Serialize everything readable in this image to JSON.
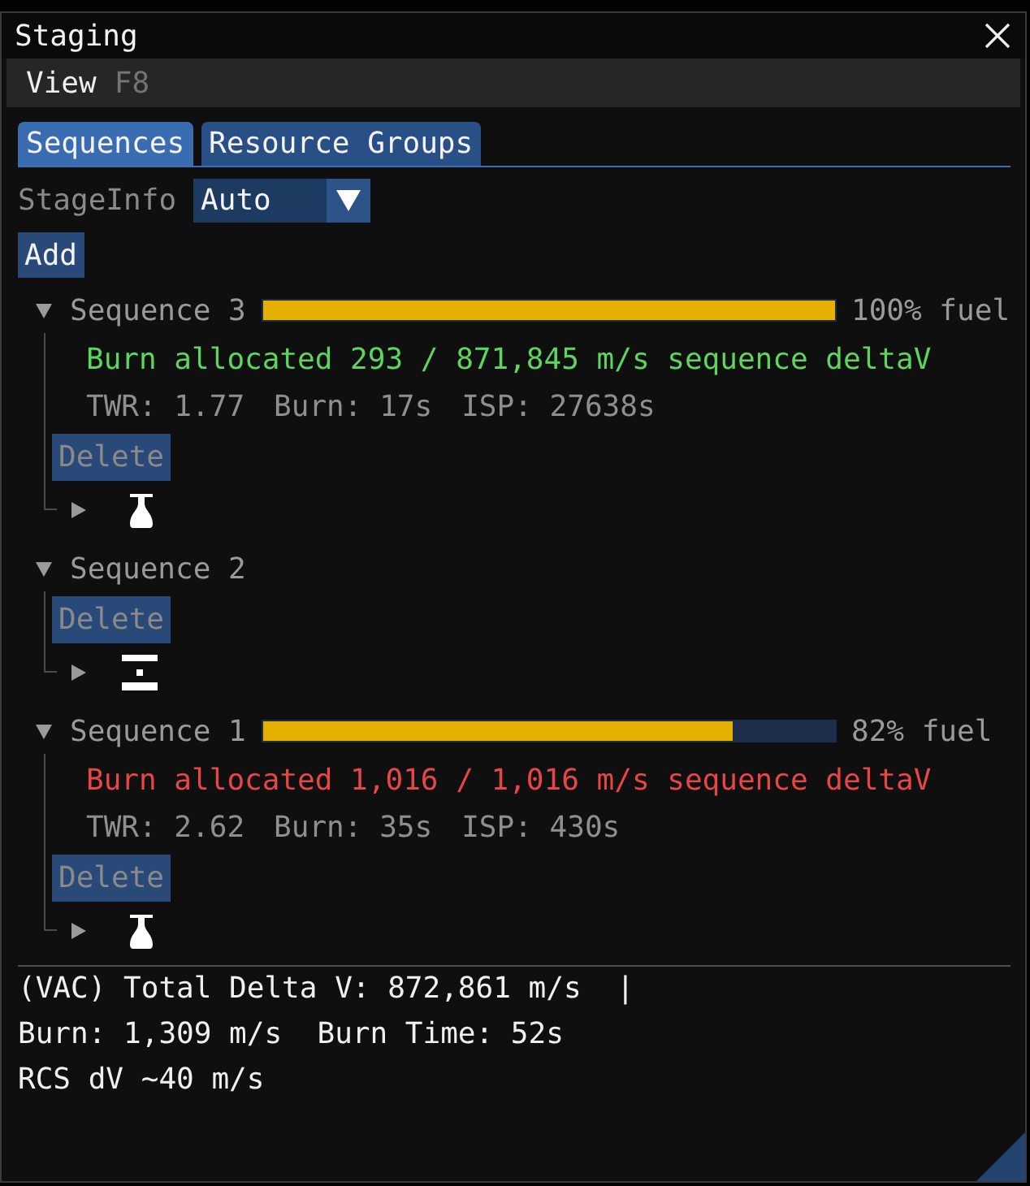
{
  "window": {
    "title": "Staging"
  },
  "menu_bar": {
    "items": [
      {
        "label": "View",
        "shortcut": "F8"
      }
    ]
  },
  "tabs": [
    {
      "label": "Sequences",
      "selected": true
    },
    {
      "label": "Resource Groups",
      "selected": false
    }
  ],
  "stage_info": {
    "label": "StageInfo",
    "value": "Auto"
  },
  "add_button": {
    "label": "Add"
  },
  "sequences": [
    {
      "name": "Sequence 3",
      "expanded": true,
      "fuel": {
        "level": 1,
        "reading": "100% fuel"
      },
      "burn": {
        "text": "Burn allocated 293 / 871,845 m/s sequence deltaV",
        "color": "#5cd65c"
      },
      "stats": [
        "TWR: 1.77",
        "Burn: 17s",
        "ISP: 27638s"
      ],
      "delete": {
        "label": "Delete",
        "disabled": true
      },
      "parts": [
        {
          "kind": "engine",
          "expanded": false
        }
      ]
    },
    {
      "name": "Sequence 2",
      "expanded": true,
      "delete": {
        "label": "Delete",
        "disabled": true
      },
      "parts": [
        {
          "kind": "decoupler",
          "expanded": false
        }
      ]
    },
    {
      "name": "Sequence 1",
      "expanded": true,
      "fuel": {
        "level": 0.82,
        "reading": "82% fuel"
      },
      "burn": {
        "text": "Burn allocated 1,016 / 1,016 m/s sequence deltaV",
        "color": "#e84545"
      },
      "stats": [
        "TWR: 2.62",
        "Burn: 35s",
        "ISP: 430s"
      ],
      "delete": {
        "label": "Delete",
        "disabled": true
      },
      "parts": [
        {
          "kind": "engine",
          "expanded": false
        }
      ]
    }
  ],
  "summary": [
    "(VAC) Total Delta V: 872,861 m/s  |",
    "Burn: 1,309 m/s  Burn Time: 52s",
    "RCS dV ~40 m/s"
  ]
}
